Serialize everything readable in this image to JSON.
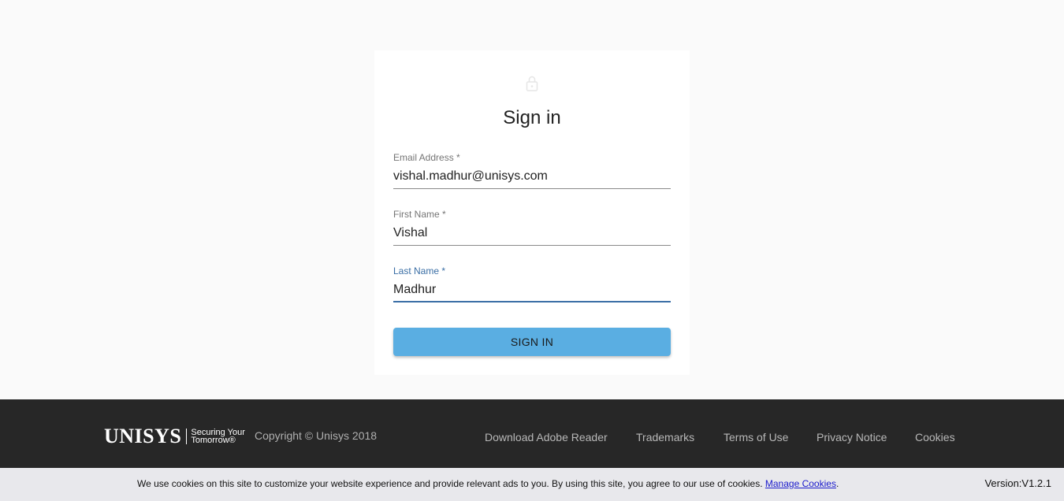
{
  "page": {
    "title": "Sign in"
  },
  "form": {
    "email": {
      "label": "Email Address *",
      "value": "vishal.madhur@unisys.com"
    },
    "first_name": {
      "label": "First Name *",
      "value": "Vishal"
    },
    "last_name": {
      "label": "Last Name *",
      "value": "Madhur"
    },
    "submit_label": "SIGN IN"
  },
  "footer": {
    "logo_word": "UNISYS",
    "logo_tagline_1": "Securing Your",
    "logo_tagline_2": "Tomorrow®",
    "copyright": "Copyright © Unisys 2018",
    "links": [
      "Download Adobe Reader",
      "Trademarks",
      "Terms of Use",
      "Privacy Notice",
      "Cookies"
    ]
  },
  "cookie_bar": {
    "text": "We use cookies on this site to customize your website experience and provide relevant ads to you. By using this site, you agree to our use of cookies.",
    "link_label": "Manage Cookies",
    "period": ".",
    "version": "Version:V1.2.1"
  },
  "colors": {
    "accent": "#3a6ea5",
    "button": "#5aaee2",
    "footer_bg": "#272727",
    "cookie_bg": "#e8e8ec"
  },
  "icons": {
    "lock": "lock-icon"
  }
}
